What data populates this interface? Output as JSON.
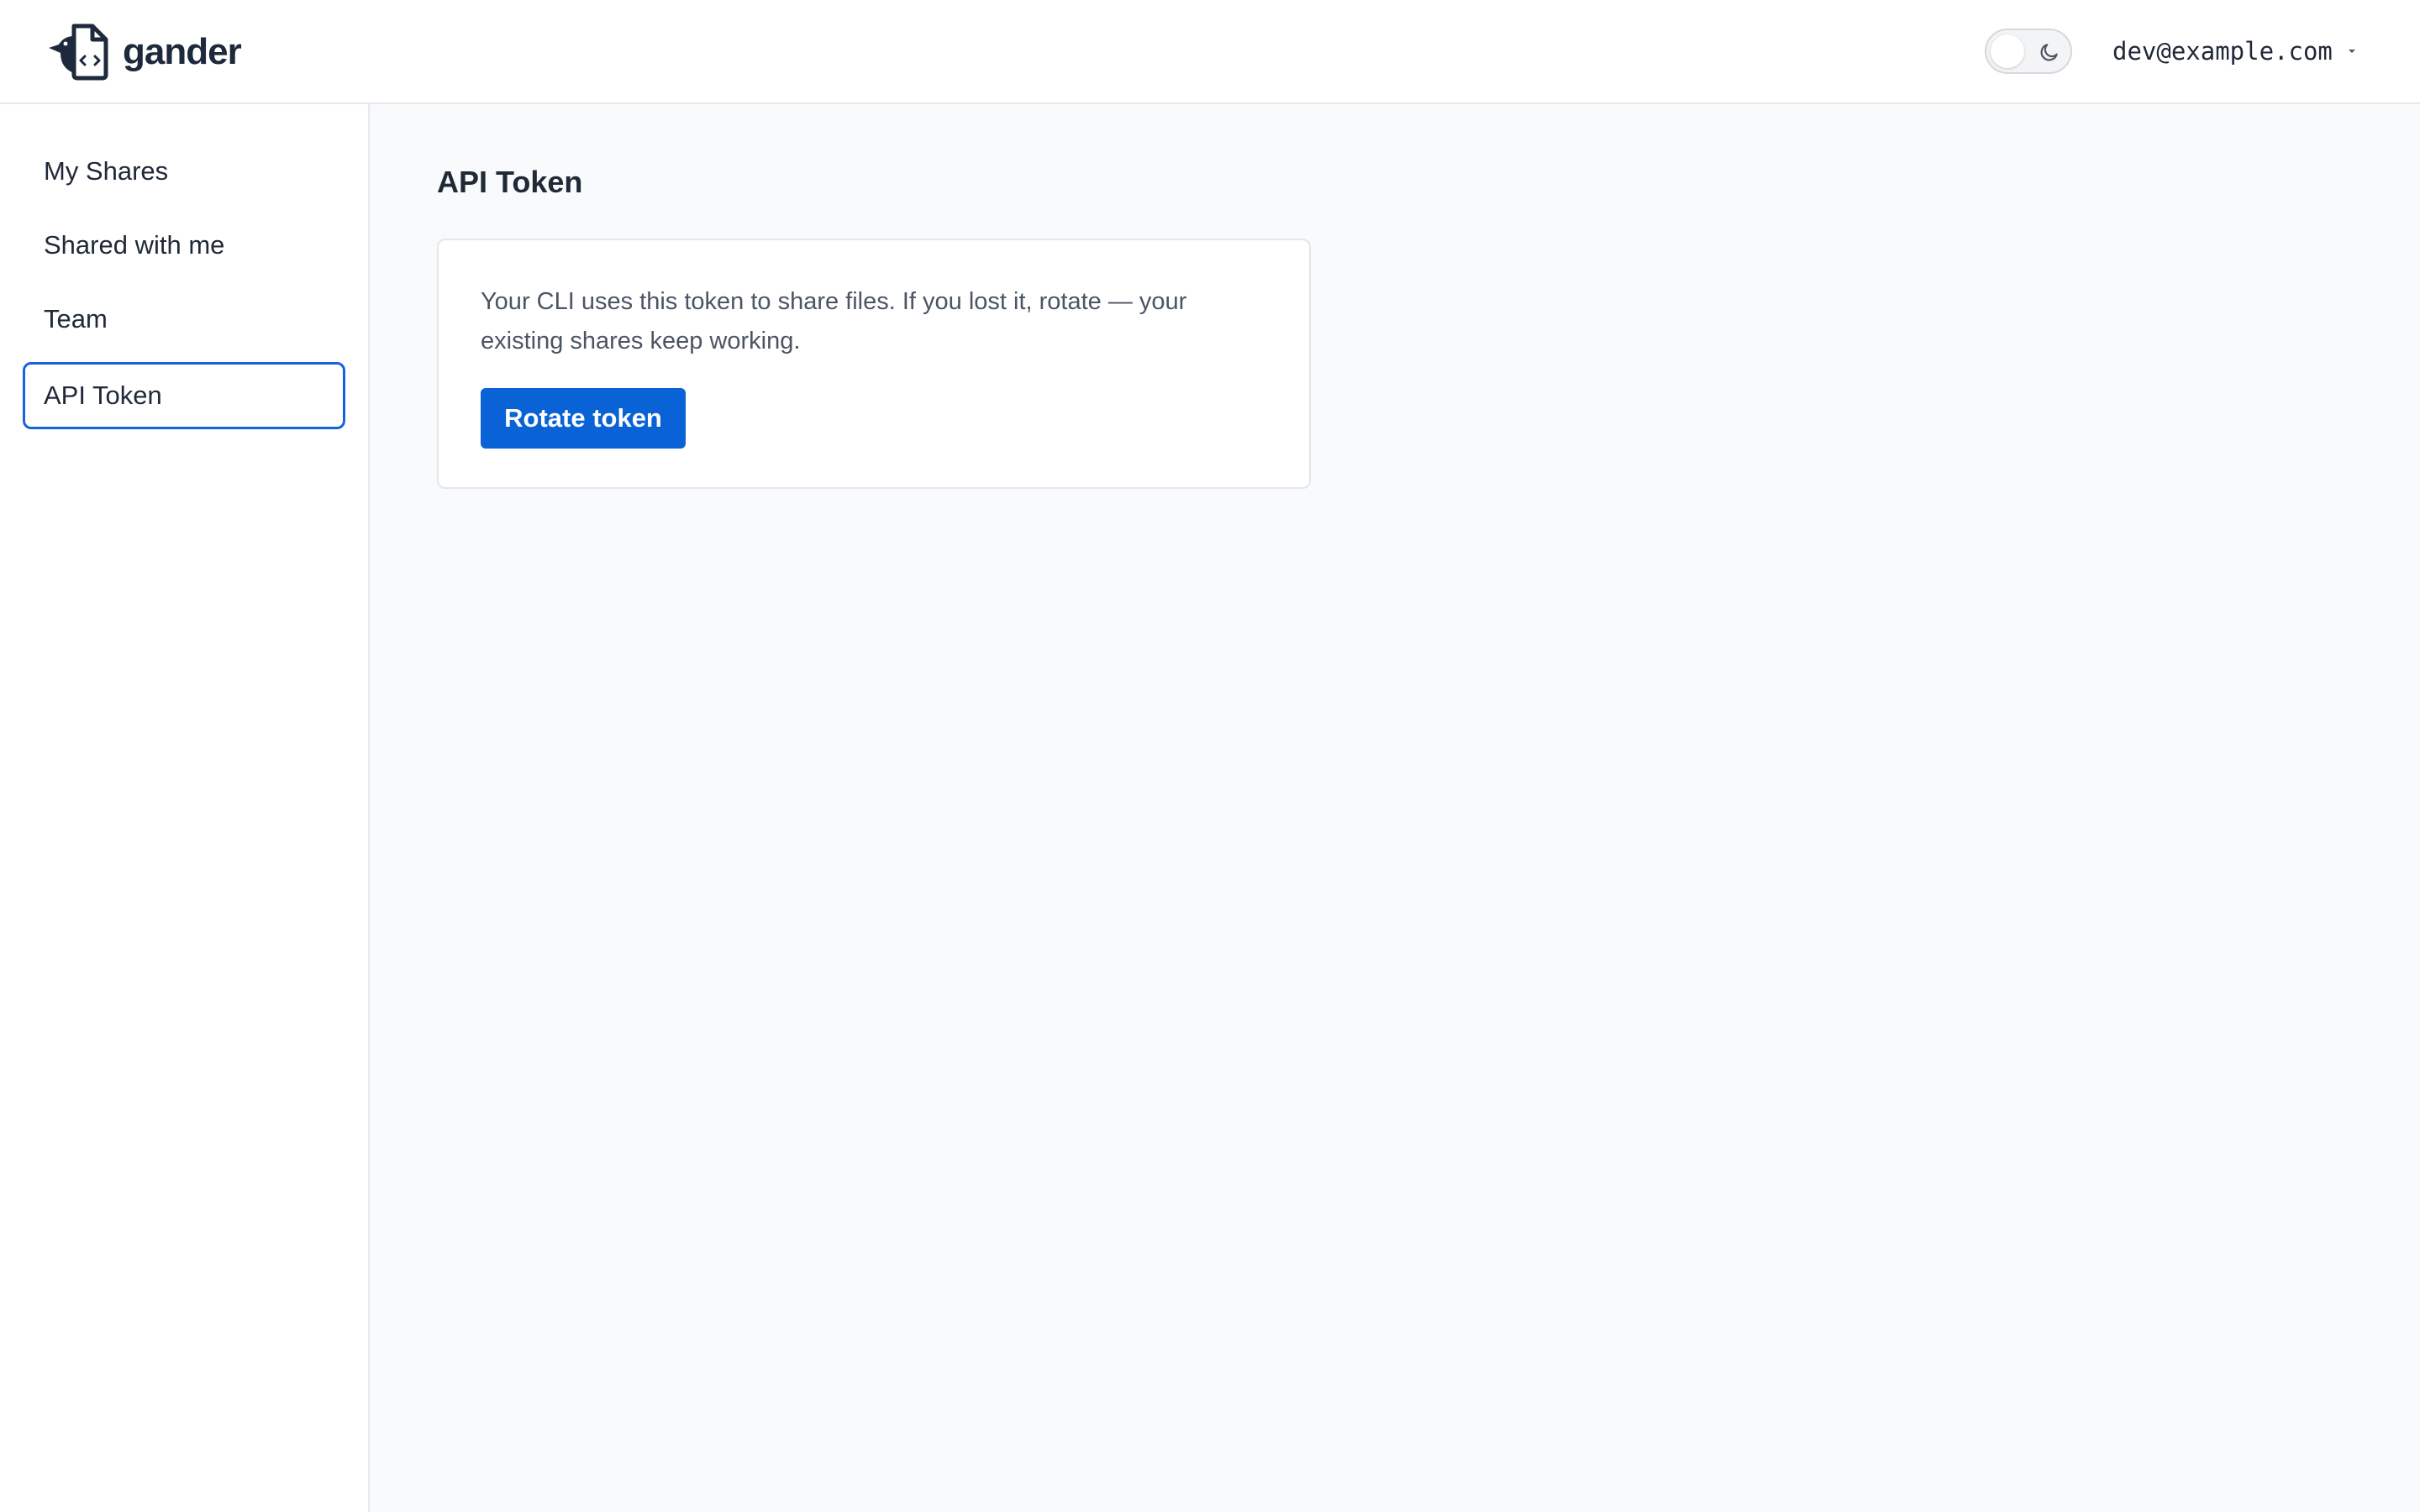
{
  "header": {
    "brand_name": "gander",
    "brand_icon": "goose-file-code-icon",
    "theme_toggle_icon": "moon-icon",
    "user_email": "dev@example.com",
    "user_menu_icon": "caret-down-icon"
  },
  "sidebar": {
    "items": [
      {
        "label": "My Shares",
        "active": false
      },
      {
        "label": "Shared with me",
        "active": false
      },
      {
        "label": "Team",
        "active": false
      },
      {
        "label": "API Token",
        "active": true
      }
    ]
  },
  "main": {
    "title": "API Token",
    "card": {
      "description": "Your CLI uses this token to share files. If you lost it, rotate — your existing shares keep working.",
      "button_label": "Rotate token"
    }
  },
  "colors": {
    "accent": "#0a63d6",
    "active_border": "#1565d8",
    "text": "#1f2937",
    "muted_text": "#4b5563",
    "background": "#f9fafc"
  }
}
